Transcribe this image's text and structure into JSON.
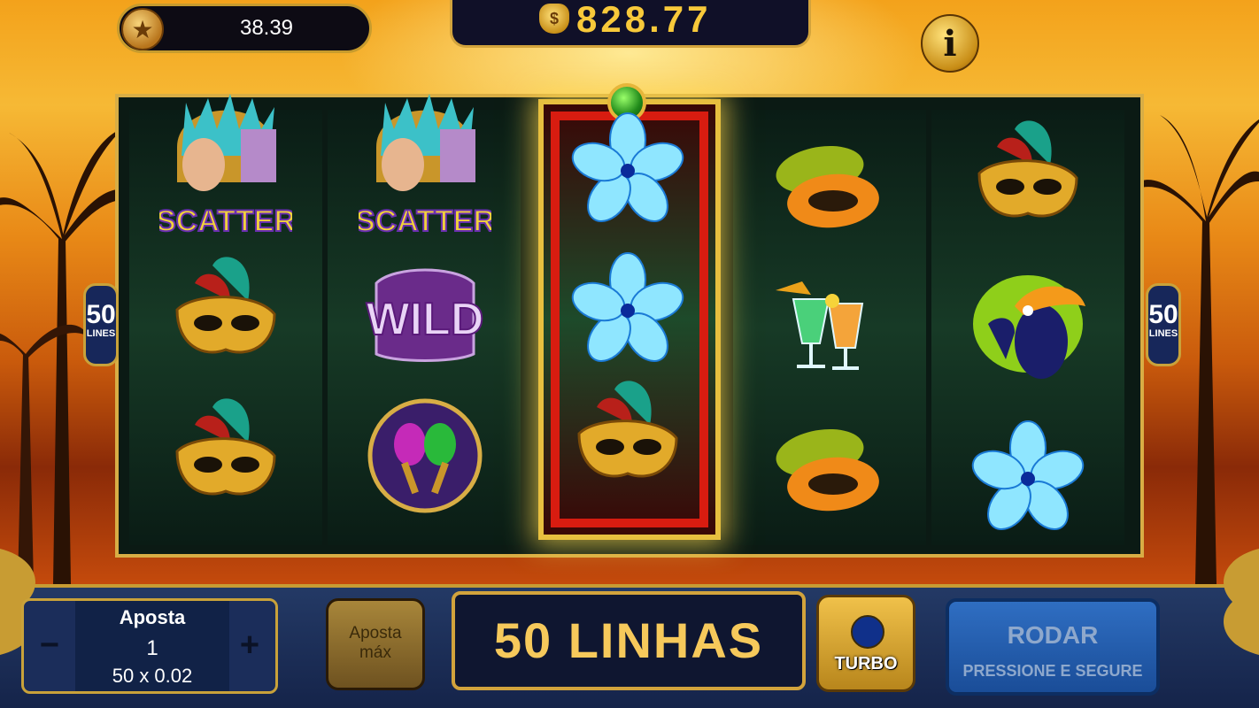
{
  "top_bar": {
    "coins_value": "38.39",
    "coin_icon": "star-coin-icon",
    "balance_value": "828.77",
    "balance_icon": "money-bag-icon",
    "info_icon": "info-icon",
    "info_label": "i"
  },
  "reels": {
    "lines_badge_left": {
      "number": "50",
      "label": "LINES"
    },
    "lines_badge_right": {
      "number": "50",
      "label": "LINES"
    },
    "columns": [
      [
        "scatter-queen",
        "carnival-mask",
        "carnival-mask"
      ],
      [
        "scatter-queen",
        "wild",
        "maracas"
      ],
      [
        "blue-flower",
        "blue-flower",
        "carnival-mask"
      ],
      [
        "papaya",
        "cocktails",
        "papaya"
      ],
      [
        "carnival-mask",
        "toucan",
        "blue-flower"
      ]
    ],
    "scatter_label": "SCATTER",
    "wild_label": "WILD",
    "highlighted_reel": 3
  },
  "controls": {
    "bet_title": "Aposta",
    "bet_value": "1",
    "bet_calc": "50 x 0.02",
    "minus_label": "−",
    "plus_label": "+",
    "max_bet_line1": "Aposta",
    "max_bet_line2": "máx",
    "lines_label": "50 LINHAS",
    "turbo_label": "TURBO",
    "spin_title": "RODAR",
    "spin_sub": "PRESSIONE E SEGURE"
  },
  "colors": {
    "gold": "#d2a33c",
    "balance_text": "#f8c93a",
    "panel_blue": "#1b2d5a",
    "spin_blue": "#2f6ec2",
    "highlight_red": "#d81c10"
  }
}
